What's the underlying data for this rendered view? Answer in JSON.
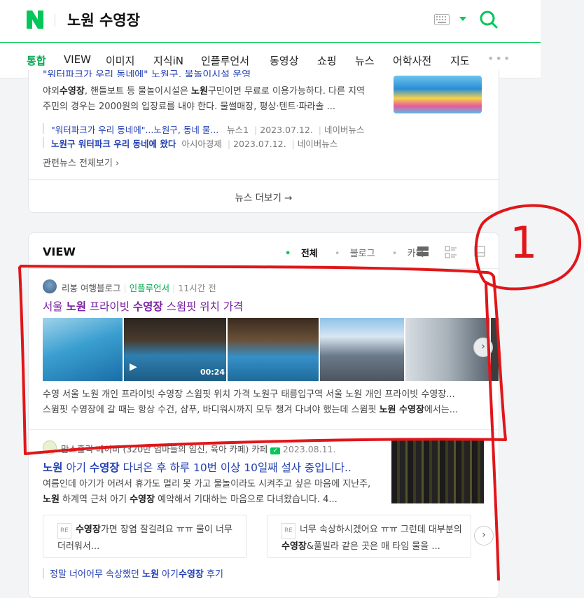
{
  "search": {
    "query": "노원 수영장"
  },
  "tabs": [
    "통합",
    "VIEW",
    "이미지",
    "지식iN",
    "인플루언서",
    "동영상",
    "쇼핑",
    "뉴스",
    "어학사전",
    "지도"
  ],
  "news": {
    "partial_title": "\"워터파크가 우리 동네에\" 노원구, 물놀이시설 운영",
    "body_pre": "야외",
    "body_kw1": "수영장",
    "body_mid": ", 핸들보트 등 물놀이시설은 ",
    "body_kw2": "노원",
    "body_post": "구민이면 무료로 이용가능하다. 다른 지역 주민의 경우는 2000원의 입장료를 내야 한다. 물썰매장, 평상·텐트·파라솔 ...",
    "sub1": {
      "title": "\"워터파크가 우리 동네에\"...노원구, 동네 물...",
      "press": "뉴스1",
      "date": "2023.07.12.",
      "portal": "네이버뉴스"
    },
    "sub2": {
      "title": "노원구 워터파크 우리 동네에 왔다",
      "press": "아시아경제",
      "date": "2023.07.12.",
      "portal": "네이버뉴스"
    },
    "related_all": "관련뉴스 전체보기 ›",
    "more": "뉴스 더보기 →"
  },
  "view": {
    "title": "VIEW",
    "filters": [
      "전체",
      "블로그",
      "카페"
    ],
    "post1": {
      "author": "리봉 여행블로그",
      "badge": "인플루언서",
      "time": "11시간 전",
      "title_a": "서울 ",
      "title_b": "노원",
      "title_c": " 프라이빗 ",
      "title_d": "수영장",
      "title_e": " 스윔핏 위치 가격",
      "video_duration": "00:24",
      "body_line1": "수영 서울 노원 개인 프라이빗 수영장 스윔핏 위치 가격 노원구 태릉입구역 서울 노원 개인 프라이빗 수영장...",
      "body_line2_a": "스윔핏 수영장에 갈 때는 항상 수건, 샴푸, 바디워시까지 모두 챙겨 다녀야 했는데 스윔핏 ",
      "body_line2_b": "노원 수영장",
      "body_line2_c": "에서는..."
    },
    "post2": {
      "author": "맘스홀릭 베이비 (320만 엄마들의 임신, 육아 카페) 카페",
      "date": "2023.08.11.",
      "title_a": "노원",
      "title_b": " 아기 ",
      "title_c": "수영장",
      "title_d": " 다녀온 후 하루 10번 이상 10일째 설사 중입니다..",
      "body_a": "여름인데 아기가 어려서 휴가도 멀리 못 가고 물놀이라도 시켜주고 싶은 마음에 지난주, ",
      "body_b": "노원",
      "body_c": " 하계역 근처 아기 ",
      "body_d": "수영장",
      "body_e": " 예약해서 기대하는 마음으로 다녀왔습니다. 4...",
      "reply1_tag": "RE",
      "reply1_a": "수영장",
      "reply1_b": "가면 장염 잘걸려요 ㅠㅠ 물이 너무 더러워서...",
      "reply2_tag": "RE",
      "reply2_a": "너무 속상하시겠어요 ㅠㅠ 그런데 대부분의 ",
      "reply2_b": "수영장",
      "reply2_c": "&풀빌라 같은 곳은 매 타임 물을 ...",
      "link_a": "정말 너어어무 속상했던 ",
      "link_b": "노원",
      "link_c": " 아기",
      "link_d": "수영장",
      "link_e": " 후기"
    }
  },
  "annotation": {
    "number": "1"
  },
  "colors": {
    "brand": "#03c75a",
    "link": "#2440b3",
    "visited": "#7a1fa2",
    "annotation": "#e0161a"
  }
}
